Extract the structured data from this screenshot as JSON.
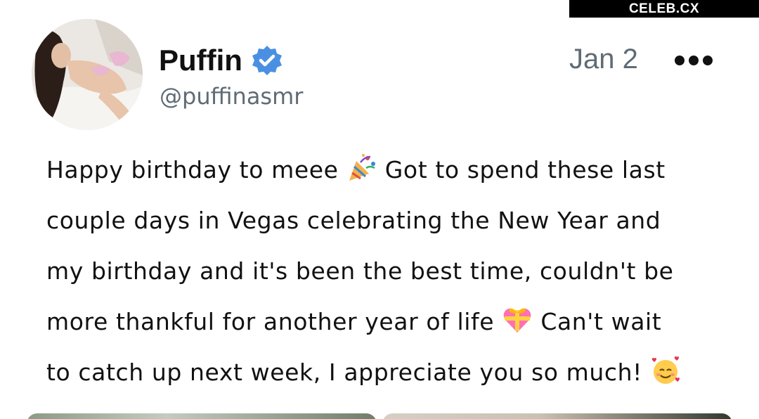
{
  "watermark": {
    "text": "CELEB.CX"
  },
  "author": {
    "display_name": "Puffin",
    "handle": "@puffinasmr",
    "verified": true,
    "verified_color": "#4a90e2"
  },
  "post": {
    "date": "Jan 2",
    "lines": [
      {
        "before": "Happy birthday to meee ",
        "emoji": "party-popper",
        "after": " Got to spend these last"
      },
      {
        "before": "couple days in Vegas celebrating the New Year and",
        "emoji": "",
        "after": ""
      },
      {
        "before": "my birthday and it's been the best time, couldn't be",
        "emoji": "",
        "after": ""
      },
      {
        "before": "more thankful for another year of life ",
        "emoji": "heart-with-ribbon",
        "after": " Can't wait"
      },
      {
        "before": "to catch up next week, I appreciate you so much! ",
        "emoji": "smiling-face-with-hearts",
        "after": ""
      }
    ]
  },
  "icons": {
    "more": "more-dots-icon",
    "verified": "verified-badge-icon"
  },
  "colors": {
    "text": "#111111",
    "secondary": "#5f6b75",
    "accent": "#4a90e2"
  }
}
